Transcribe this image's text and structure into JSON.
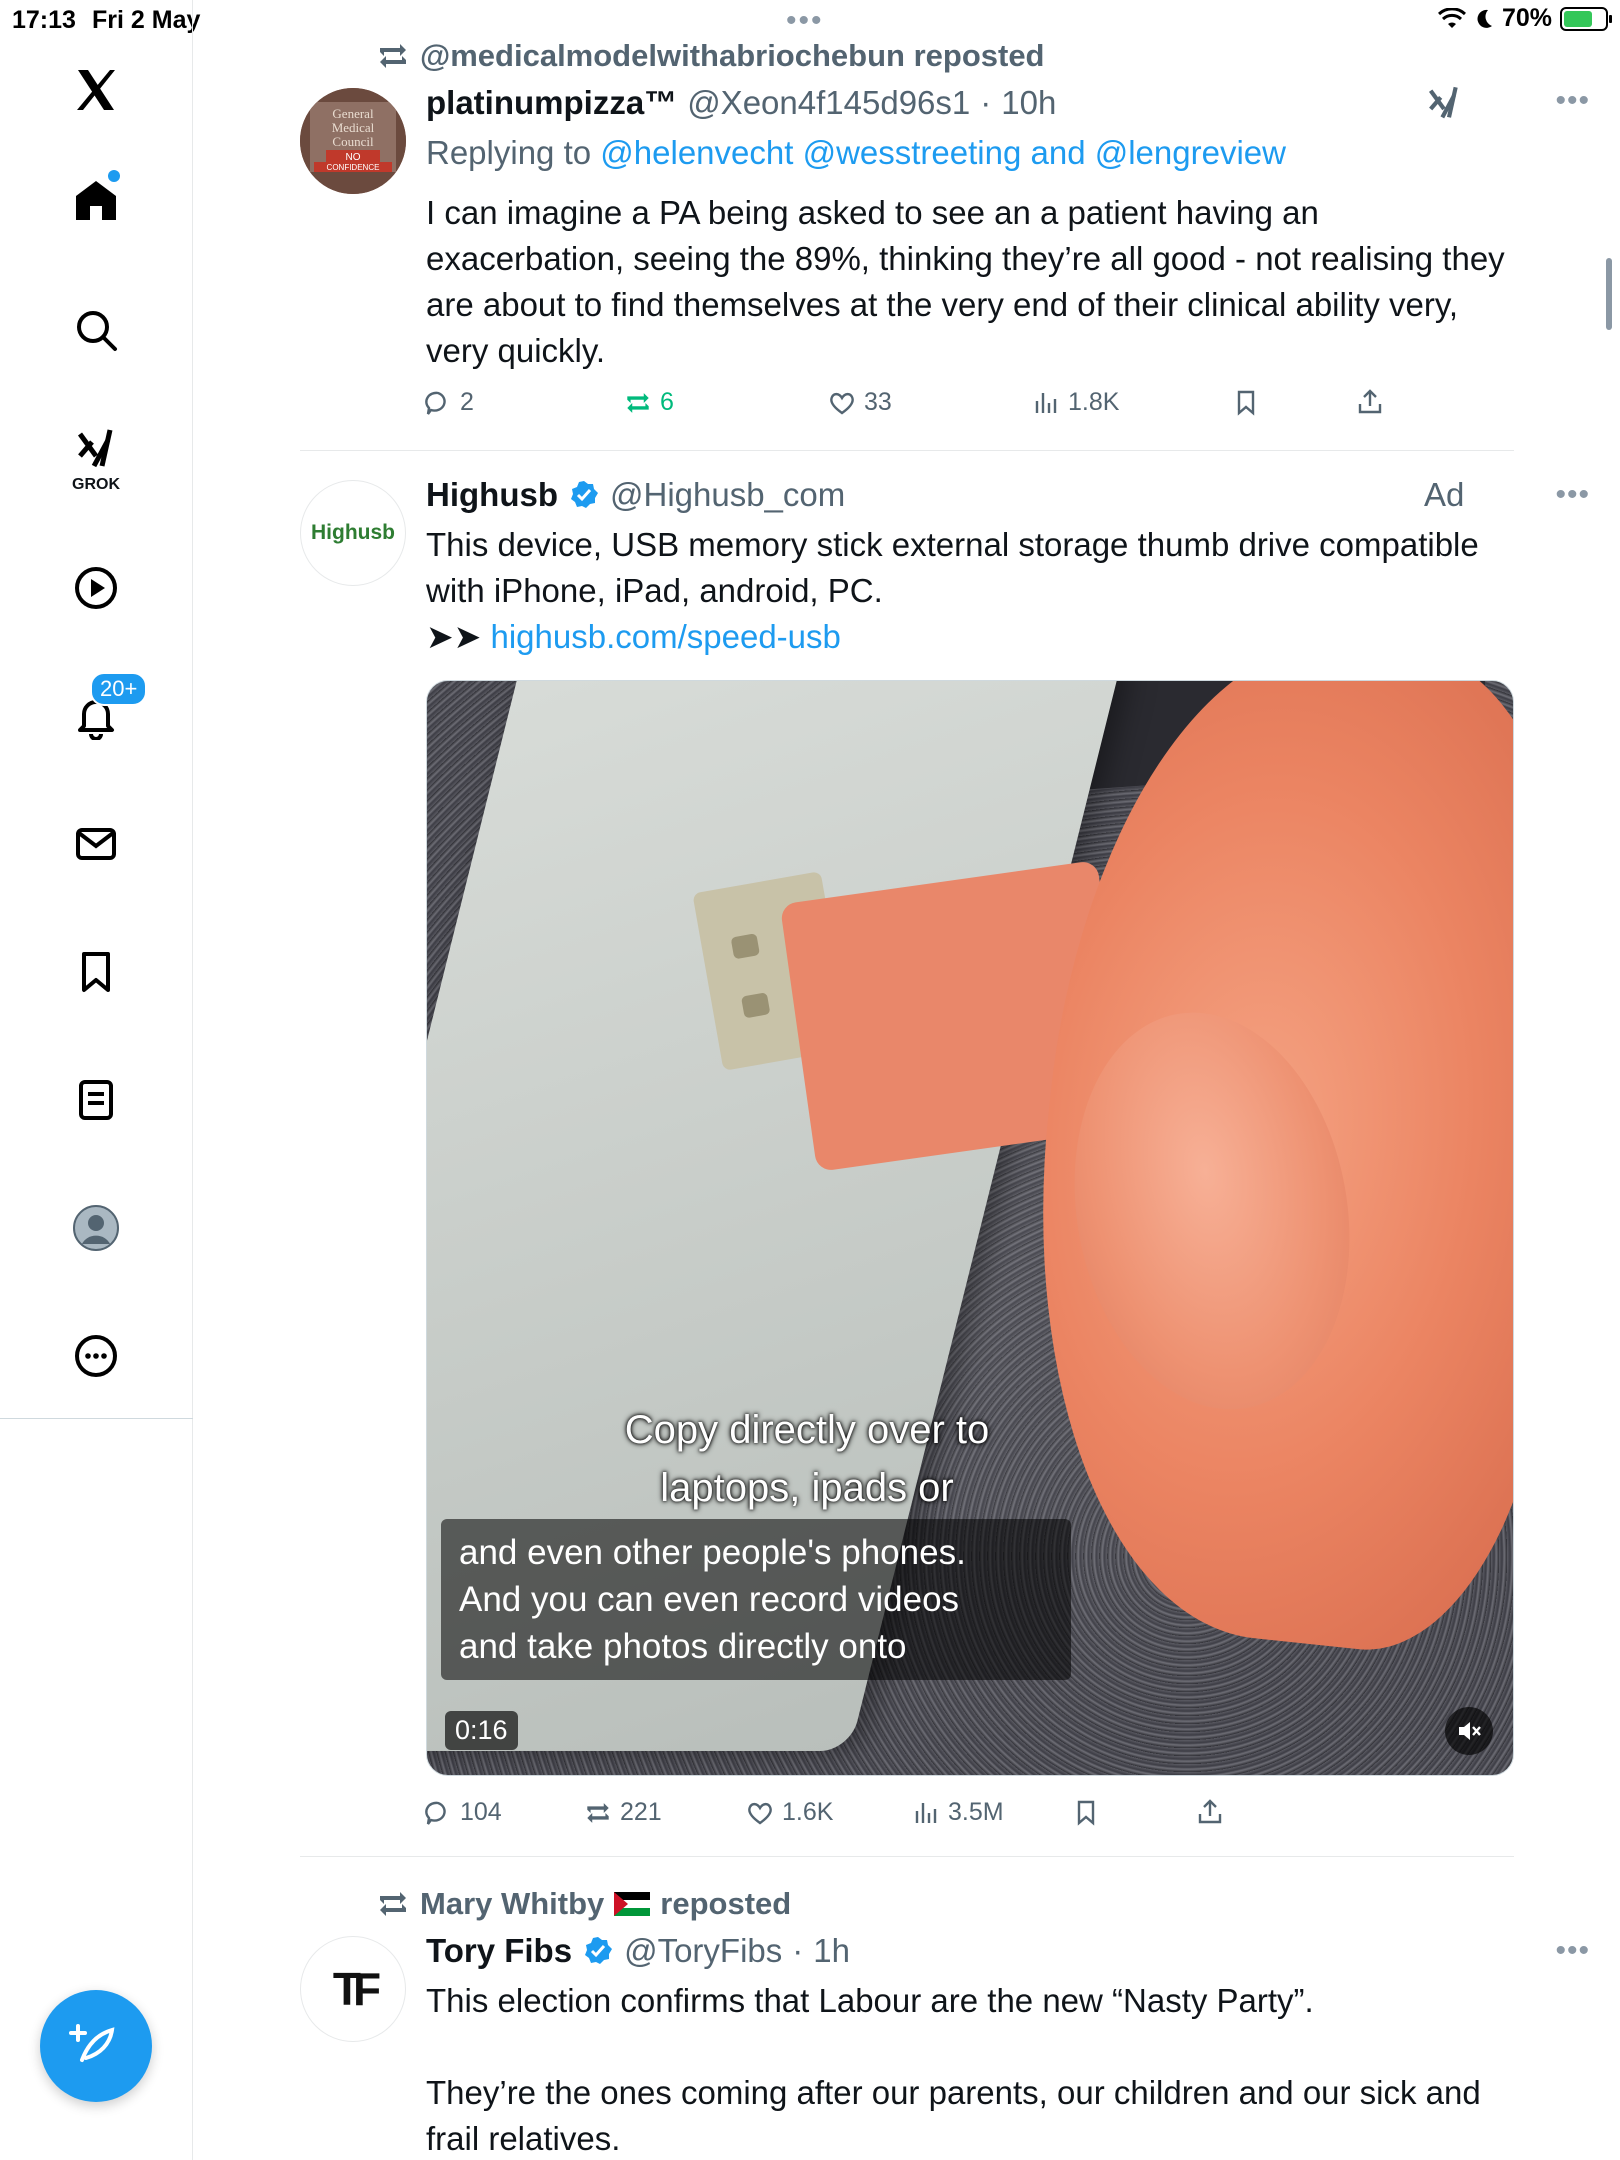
{
  "status_bar": {
    "time": "17:13",
    "date": "Fri 2 May",
    "battery": "70%",
    "battery_level": 0.7
  },
  "sidebar": {
    "items": [
      {
        "name": "x-logo",
        "icon": "x-logo-icon"
      },
      {
        "name": "home",
        "icon": "home-icon",
        "has_dot": true
      },
      {
        "name": "search",
        "icon": "search-icon"
      },
      {
        "name": "grok",
        "icon": "grok-icon",
        "label": "GROK"
      },
      {
        "name": "video",
        "icon": "play-icon"
      },
      {
        "name": "notifications",
        "icon": "bell-icon",
        "badge": "20+"
      },
      {
        "name": "messages",
        "icon": "mail-icon"
      },
      {
        "name": "bookmarks",
        "icon": "bookmark-icon"
      },
      {
        "name": "lists",
        "icon": "list-icon"
      },
      {
        "name": "profile",
        "icon": "avatar-icon"
      },
      {
        "name": "more",
        "icon": "more-circle-icon"
      }
    ],
    "compose_icon": "compose-icon"
  },
  "tweets": [
    {
      "repost_by": "@medicalmodelwithabriochebun reposted",
      "name": "platinumpizza™",
      "handle": "@Xeon4f145d96s1",
      "time": "10h",
      "replying_prefix": "Replying to",
      "replying_to": "@helenvecht @wesstreeting and @lengreview",
      "text": "I can imagine a PA being asked to see an a patient having an exacerbation, seeing the 89%, thinking they’re all good - not realising they are about to find themselves at the very end of their clinical ability very, very quickly.",
      "avatar_text": [
        "General",
        "Medical",
        "Council",
        "NO",
        "CONFIDENCE"
      ],
      "replies": "2",
      "reposts": "6",
      "likes": "33",
      "views": "1.8K"
    },
    {
      "name": "Highusb",
      "handle": "@Highusb_com",
      "ad_label": "Ad",
      "avatar_text": "Highusb",
      "text_line1": "This device, USB memory stick external storage thumb drive compatible with iPhone, iPad, android, PC.",
      "arrow": "➤➤",
      "link": "highusb.com/speed-usb",
      "video": {
        "caption_top": [
          "Copy directly over to",
          "laptops, ipads or"
        ],
        "caption_box": [
          "and even other people's phones.",
          "And you can even record videos",
          "and take photos directly onto"
        ],
        "duration": "0:16"
      },
      "replies": "104",
      "reposts": "221",
      "likes": "1.6K",
      "views": "3.5M"
    },
    {
      "repost_by": "Mary Whitby",
      "repost_suffix": "reposted",
      "name": "Tory Fibs",
      "handle": "@ToryFibs",
      "time": "1h",
      "avatar_text": "TF",
      "text_line1": "This election confirms that Labour are the new “Nasty Party”.",
      "text_line2": "They’re the ones coming after our parents, our children and our sick and frail relatives."
    }
  ],
  "colors": {
    "accent": "#1d9bf0",
    "secondary_text": "#536471",
    "repost_active": "#00ba7c"
  }
}
